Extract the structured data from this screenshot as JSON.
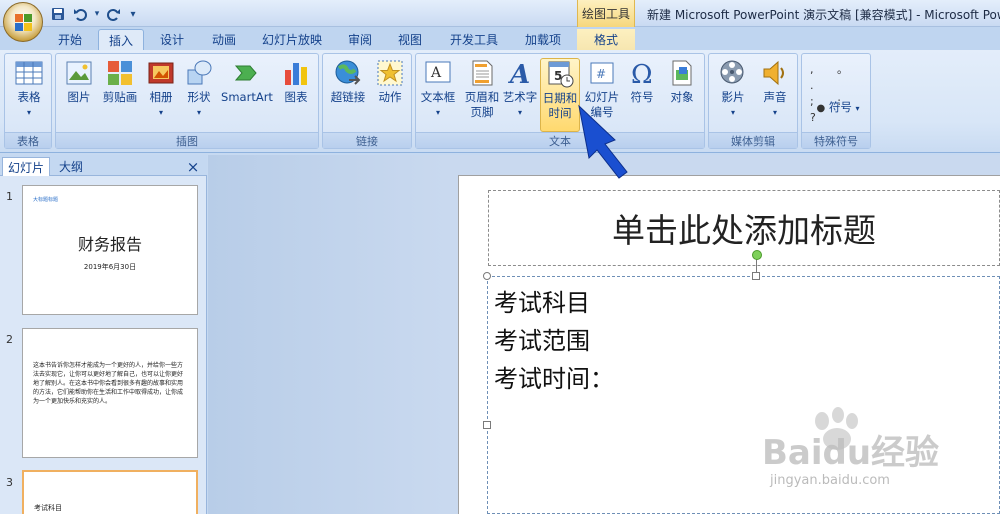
{
  "title_bar": {
    "window_title": "新建 Microsoft PowerPoint 演示文稿 [兼容模式] - Microsoft Pow",
    "context_tool": "绘图工具",
    "qat": {
      "save_icon": "save-icon",
      "undo_icon": "undo-icon",
      "redo_icon": "redo-icon",
      "customize": "▾"
    }
  },
  "tabs": [
    {
      "label": "开始"
    },
    {
      "label": "插入"
    },
    {
      "label": "设计"
    },
    {
      "label": "动画"
    },
    {
      "label": "幻灯片放映"
    },
    {
      "label": "审阅"
    },
    {
      "label": "视图"
    },
    {
      "label": "开发工具"
    },
    {
      "label": "加载项"
    },
    {
      "label": "格式"
    }
  ],
  "ribbon": {
    "groups": {
      "table": "表格",
      "illustrations": "插图",
      "links": "链接",
      "text": "文本",
      "media": "媒体剪辑",
      "symbols": "特殊符号"
    },
    "buttons": {
      "table": "表格",
      "picture": "图片",
      "clipart": "剪贴画",
      "album": "相册",
      "shapes": "形状",
      "smartart": "SmartArt",
      "chart": "图表",
      "hyperlink": "超链接",
      "action": "动作",
      "textbox": "文本框",
      "header_footer_1": "页眉和",
      "header_footer_2": "页脚",
      "wordart": "艺术字",
      "datetime_1": "日期和",
      "datetime_2": "时间",
      "slide_number_1": "幻灯片",
      "slide_number_2": "编号",
      "symbol": "符号",
      "object": "对象",
      "movie": "影片",
      "sound": "声音",
      "special_symbol": "符号"
    }
  },
  "panel": {
    "tab_slides": "幻灯片",
    "tab_outline": "大纲",
    "close": "×",
    "slides": [
      {
        "num": "1",
        "header": "大标题标题",
        "title": "财务报告",
        "date": "2019年6月30日"
      },
      {
        "num": "2",
        "body": "这本书告诉你怎样才能成为一个更好的人，并给你一些方法去实现它，让你可以更好地了解自己，也可以让你更好地了解别人。在这本书中你会看到很多有趣的故事和实用的方法，它们能帮助你在生活和工作中取得成功，让你成为一个更加快乐和充实的人。"
      },
      {
        "num": "3",
        "body": "考试科目"
      }
    ]
  },
  "slide": {
    "title_placeholder": "单击此处添加标题",
    "lines": [
      "考试科目",
      "考试范围",
      "考试时间："
    ]
  },
  "watermark": {
    "logo": "Baidu经验",
    "url": "jingyan.baidu.com"
  },
  "colors": {
    "accent": "#15428b",
    "pointer": "#1a4fd0",
    "highlight": "#ffd96f"
  }
}
